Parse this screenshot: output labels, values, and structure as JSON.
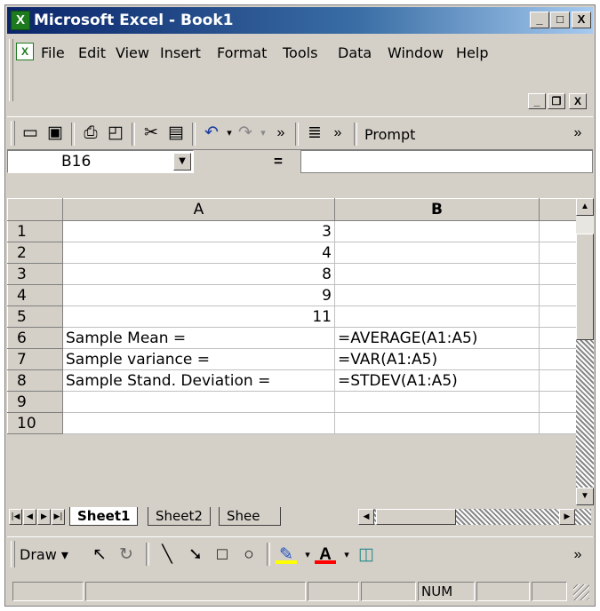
{
  "window": {
    "title": "Microsoft Excel - Book1"
  },
  "titlebar_buttons": {
    "minimize": "_",
    "maximize": "□",
    "close": "X"
  },
  "menubar": {
    "items": [
      {
        "label": "File"
      },
      {
        "label": "Edit"
      },
      {
        "label": "View"
      },
      {
        "label": "Insert"
      },
      {
        "label": "Format"
      },
      {
        "label": "Tools"
      },
      {
        "label": "Data"
      },
      {
        "label": "Window"
      },
      {
        "label": "Help"
      }
    ],
    "doc_buttons": {
      "minimize": "_",
      "restore": "❐",
      "close": "X"
    }
  },
  "toolbar": {
    "tools": [
      {
        "name": "new-icon",
        "glyph": "🗋"
      },
      {
        "name": "save-icon",
        "glyph": "▪"
      },
      {
        "name": "print-icon",
        "glyph": "⎙"
      },
      {
        "name": "print-preview-icon",
        "glyph": "🔍"
      },
      {
        "name": "cut-icon",
        "glyph": "✂"
      },
      {
        "name": "paste-icon",
        "glyph": "📋"
      },
      {
        "name": "undo-icon",
        "glyph": "↶"
      },
      {
        "name": "redo-icon",
        "glyph": "↷"
      },
      {
        "name": "align-icon",
        "glyph": "≡"
      }
    ],
    "prompt_label": "Prompt",
    "overflow": "»"
  },
  "formula_bar": {
    "name_box": "B16",
    "equals": "=",
    "value": ""
  },
  "sheet": {
    "columns": [
      "A",
      "B"
    ],
    "rows": [
      {
        "num": "1",
        "a": "3",
        "b": "",
        "a_num": true
      },
      {
        "num": "2",
        "a": "4",
        "b": "",
        "a_num": true
      },
      {
        "num": "3",
        "a": "8",
        "b": "",
        "a_num": true
      },
      {
        "num": "4",
        "a": "9",
        "b": "",
        "a_num": true
      },
      {
        "num": "5",
        "a": "11",
        "b": "",
        "a_num": true
      },
      {
        "num": "6",
        "a": "Sample Mean =",
        "b": "=AVERAGE(A1:A5)",
        "a_num": false
      },
      {
        "num": "7",
        "a": "Sample variance =",
        "b": "=VAR(A1:A5)",
        "a_num": false
      },
      {
        "num": "8",
        "a": "Sample Stand. Deviation =",
        "b": "=STDEV(A1:A5)",
        "a_num": false
      },
      {
        "num": "9",
        "a": "",
        "b": "",
        "a_num": false
      },
      {
        "num": "10",
        "a": "",
        "b": "",
        "a_num": false
      }
    ]
  },
  "tabs": [
    "Sheet1",
    "Sheet2",
    "Shee"
  ],
  "active_tab": "Sheet1",
  "drawbar": {
    "draw_label": "Draw"
  },
  "statusbar": {
    "num": "NUM"
  }
}
